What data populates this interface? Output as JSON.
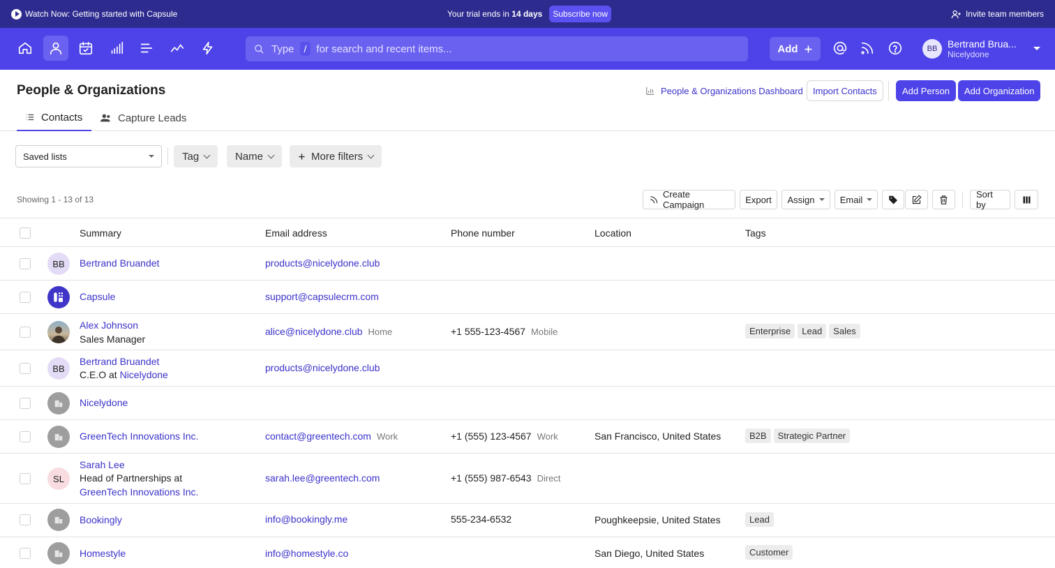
{
  "banner": {
    "watch_text": "Watch Now: Getting started with Capsule",
    "trial_prefix": "Your trial ends in ",
    "trial_days": "14 days",
    "subscribe_label": "Subscribe now",
    "invite_label": "Invite team members"
  },
  "nav": {
    "icons": [
      "home-icon",
      "person-icon",
      "calendar-check-icon",
      "bar-chart-icon",
      "list-icon",
      "trend-icon",
      "lightning-icon"
    ],
    "active_icon": "person-icon",
    "search": {
      "prefix": "Type",
      "key": "/",
      "suffix": "for search and recent items..."
    },
    "add_label": "Add",
    "user": {
      "initials": "BB",
      "name": "Bertrand Brua...",
      "org": "Nicelydone"
    }
  },
  "page": {
    "title": "People & Organizations",
    "dashboard_link": "People & Organizations Dashboard",
    "import_label": "Import Contacts",
    "add_person_label": "Add Person",
    "add_org_label": "Add Organization"
  },
  "tabs": [
    {
      "label": "Contacts",
      "icon": "list-icon",
      "active": true
    },
    {
      "label": "Capture Leads",
      "icon": "people-icon",
      "active": false
    }
  ],
  "filters": {
    "saved_lists": "Saved lists",
    "tag": "Tag",
    "name": "Name",
    "more": "More filters"
  },
  "toolbar": {
    "showing": "Showing 1 - 13 of 13",
    "create_campaign": "Create Campaign",
    "export": "Export",
    "assign": "Assign",
    "email": "Email",
    "sort_by": "Sort by"
  },
  "table": {
    "headers": {
      "summary": "Summary",
      "email": "Email address",
      "phone": "Phone number",
      "location": "Location",
      "tags": "Tags"
    },
    "rows": [
      {
        "avatar": "BB",
        "name": "Bertrand Bruandet",
        "email": "products@nicelydone.club"
      },
      {
        "name": "Capsule",
        "email": "support@capsulecrm.com"
      },
      {
        "name": "Alex Johnson",
        "sub": "Sales Manager",
        "email": "alice@nicelydone.club",
        "email_type": "Home",
        "phone": "+1 555-123-4567",
        "phone_type": "Mobile",
        "tags": [
          "Enterprise",
          "Lead",
          "Sales"
        ]
      },
      {
        "avatar": "BB",
        "name": "Bertrand Bruandet",
        "sub_prefix": "C.E.O at ",
        "sub_org": "Nicelydone",
        "email": "products@nicelydone.club"
      },
      {
        "name": "Nicelydone"
      },
      {
        "name": "GreenTech Innovations Inc.",
        "email": "contact@greentech.com",
        "email_type": "Work",
        "phone": "+1 (555) 123-4567",
        "phone_type": "Work",
        "location": "San Francisco, United States",
        "tags": [
          "B2B",
          "Strategic Partner"
        ]
      },
      {
        "avatar": "SL",
        "name": "Sarah Lee",
        "sub": "Head of Partnerships at",
        "sub_org": "GreenTech Innovations Inc.",
        "email": "sarah.lee@greentech.com",
        "phone": "+1 (555) 987-6543",
        "phone_type": "Direct"
      },
      {
        "name": "Bookingly",
        "email": "info@bookingly.me",
        "phone": "555-234-6532",
        "location": "Poughkeepsie, United States",
        "tags": [
          "Lead"
        ]
      },
      {
        "name": "Homestyle",
        "email": "info@homestyle.co",
        "location": "San Diego, United States",
        "tags": [
          "Customer"
        ]
      }
    ]
  },
  "colors": {
    "banner": "#2e2b8f",
    "nav": "#4d43e8",
    "accent": "#5b50f0",
    "link": "#3b32c9"
  }
}
